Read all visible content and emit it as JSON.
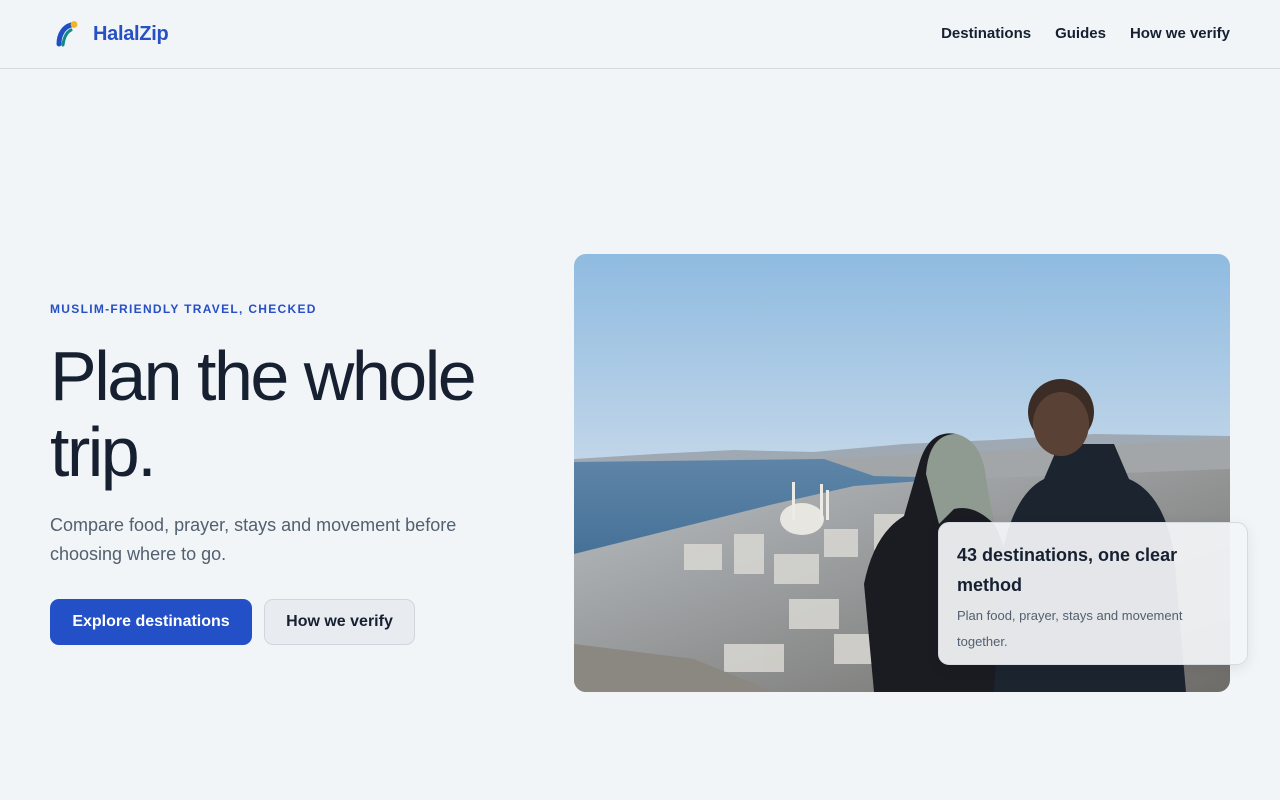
{
  "brand": {
    "name": "HalalZip",
    "logo_icon": "arc-logo-icon",
    "accent_color": "#2750c4"
  },
  "nav": {
    "items": [
      {
        "label": "Destinations"
      },
      {
        "label": "Guides"
      },
      {
        "label": "How we verify"
      }
    ]
  },
  "hero": {
    "eyebrow": "MUSLIM-FRIENDLY TRAVEL, CHECKED",
    "headline": "Plan the whole trip.",
    "subtitle": "Compare food, prayer, stays and movement before choosing where to go.",
    "primary_button": "Explore destinations",
    "secondary_button": "How we verify",
    "image": "travel-photo-couple-overlooking-city-and-sea"
  },
  "card": {
    "title": "43 destinations, one clear method",
    "text": "Plan food, prayer, stays and movement together."
  }
}
